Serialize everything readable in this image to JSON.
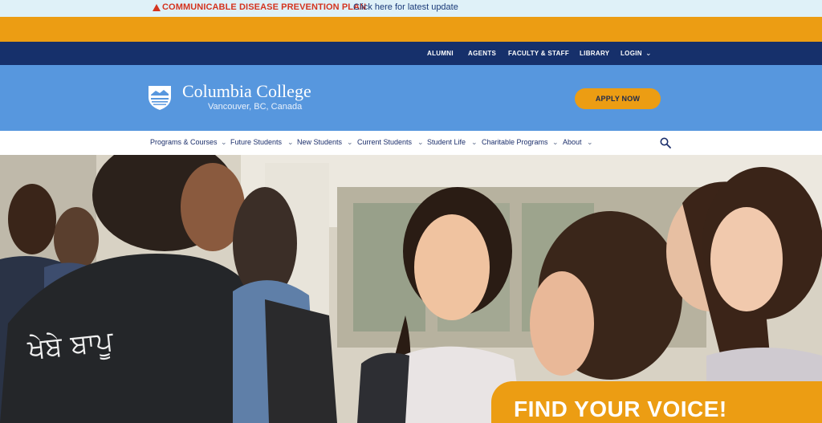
{
  "alert": {
    "title": "COMMUNICABLE DISEASE PREVENTION PLAN",
    "link": "Click here for latest update"
  },
  "utility_nav": {
    "items": [
      "ALUMNI",
      "AGENTS",
      "FACULTY & STAFF",
      "LIBRARY",
      "LOGIN"
    ]
  },
  "brand": {
    "name": "Columbia College",
    "location": "Vancouver, BC, Canada"
  },
  "apply_button": "APPLY NOW",
  "main_nav": {
    "items": [
      "Programs & Courses",
      "Future Students",
      "New Students",
      "Current Students",
      "Student Life",
      "Charitable Programs",
      "About"
    ]
  },
  "hero": {
    "shirt_text": "ਖੇਬੇ ਬਾਪੂ",
    "tagline": "FIND YOUR VOICE!"
  },
  "colors": {
    "accent_orange": "#ec9d13",
    "navy": "#16306b",
    "brand_blue": "#5797de",
    "alert_red": "#d4341f"
  }
}
